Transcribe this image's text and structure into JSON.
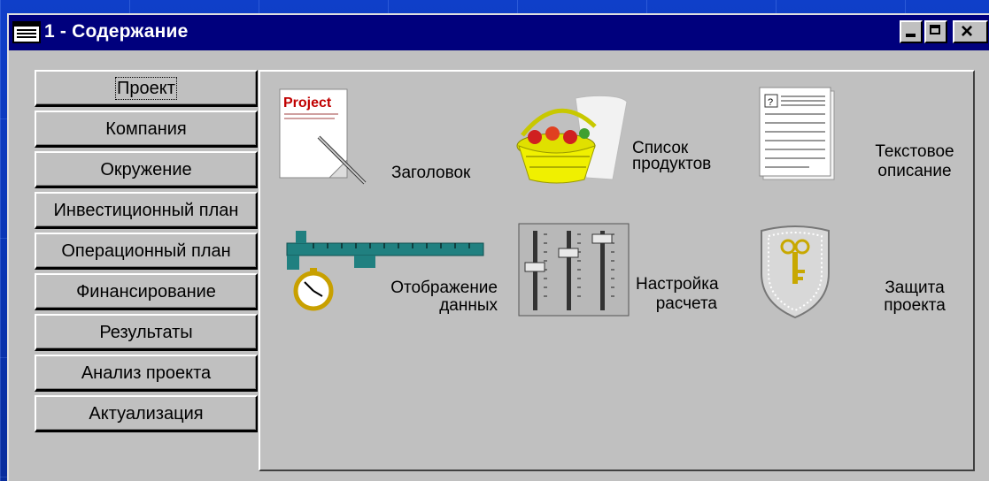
{
  "window": {
    "title": "1 - Содержание"
  },
  "sidebar": {
    "items": [
      {
        "label": "Проект",
        "active": true
      },
      {
        "label": "Компания"
      },
      {
        "label": "Окружение"
      },
      {
        "label": "Инвестиционный план"
      },
      {
        "label": "Операционный план"
      },
      {
        "label": "Финансирование"
      },
      {
        "label": "Результаты"
      },
      {
        "label": "Анализ проекта"
      },
      {
        "label": "Актуализация"
      }
    ]
  },
  "main": {
    "items": [
      {
        "icon": "project-page-icon",
        "label1": "Заголовок",
        "label2": "",
        "icon_text": "Project"
      },
      {
        "icon": "basket-icon",
        "label1": "Список",
        "label2": "продуктов"
      },
      {
        "icon": "text-document-icon",
        "label1": "Текстовое",
        "label2": "описание",
        "icon_text": "?"
      },
      {
        "icon": "caliper-stopwatch-icon",
        "label1": "Отображение",
        "label2": "данных"
      },
      {
        "icon": "sliders-icon",
        "label1": "Настройка",
        "label2": "расчета"
      },
      {
        "icon": "shield-key-icon",
        "label1": "Защита",
        "label2": "проекта"
      }
    ]
  },
  "colors": {
    "titlebar": "#00007d",
    "window": "#c0c0c0",
    "desktop": "#0a35b4"
  }
}
